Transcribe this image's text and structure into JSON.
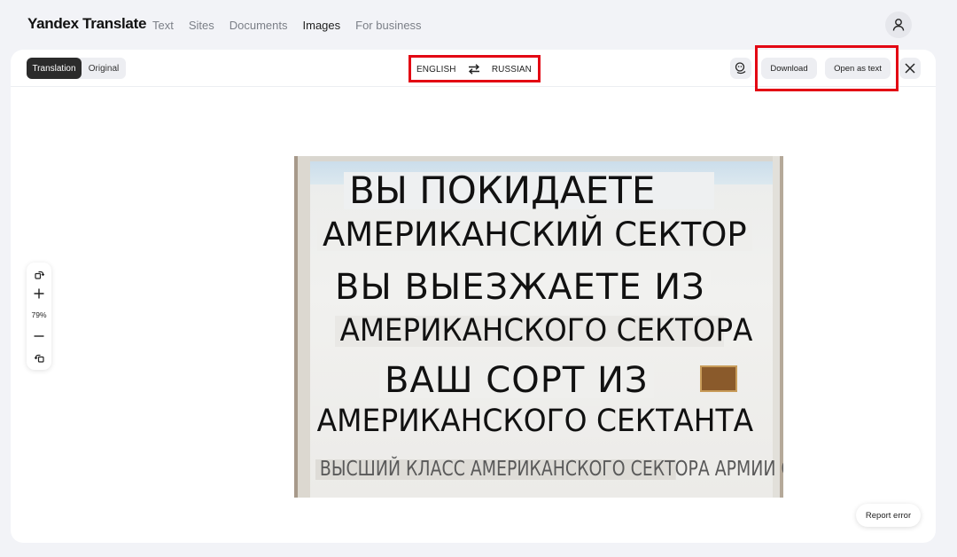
{
  "app": {
    "brand": "Yandex Translate",
    "nav": [
      "Text",
      "Sites",
      "Documents",
      "Images",
      "For business"
    ],
    "active_nav": "Images"
  },
  "toolbar": {
    "view_tabs": {
      "translation": "Translation",
      "original": "Original",
      "selected": "Translation"
    },
    "source_lang": "ENGLISH",
    "target_lang": "RUSSIAN",
    "download_label": "Download",
    "open_as_text_label": "Open as text"
  },
  "zoom": {
    "level": "79%"
  },
  "image": {
    "lines": [
      "ВЫ ПОКИДАЕТЕ",
      "АМЕРИКАНСКИЙ СЕКТОР",
      "ВЫ ВЫЕЗЖАЕТЕ ИЗ",
      "АМЕРИКАНСКОГО СЕКТОРА",
      "ВАШ СОРТ ИЗ",
      "АМЕРИКАНСКОГО СЕКТАНТА",
      "ВЫСШИЙ КЛАСС АМЕРИКАНСКОГО СЕКТОРА АРМИИ США"
    ]
  },
  "footer": {
    "report_label": "Report error"
  },
  "colors": {
    "highlight": "#e30613",
    "accent_dark": "#2b2b2b",
    "panel_bg": "#ffffff",
    "page_bg": "#f2f3f7"
  },
  "icons": [
    "user-icon",
    "swap-icon",
    "feedback-icon",
    "close-icon",
    "rotate-icon",
    "zoom-in-icon",
    "zoom-out-icon",
    "fit-icon"
  ]
}
